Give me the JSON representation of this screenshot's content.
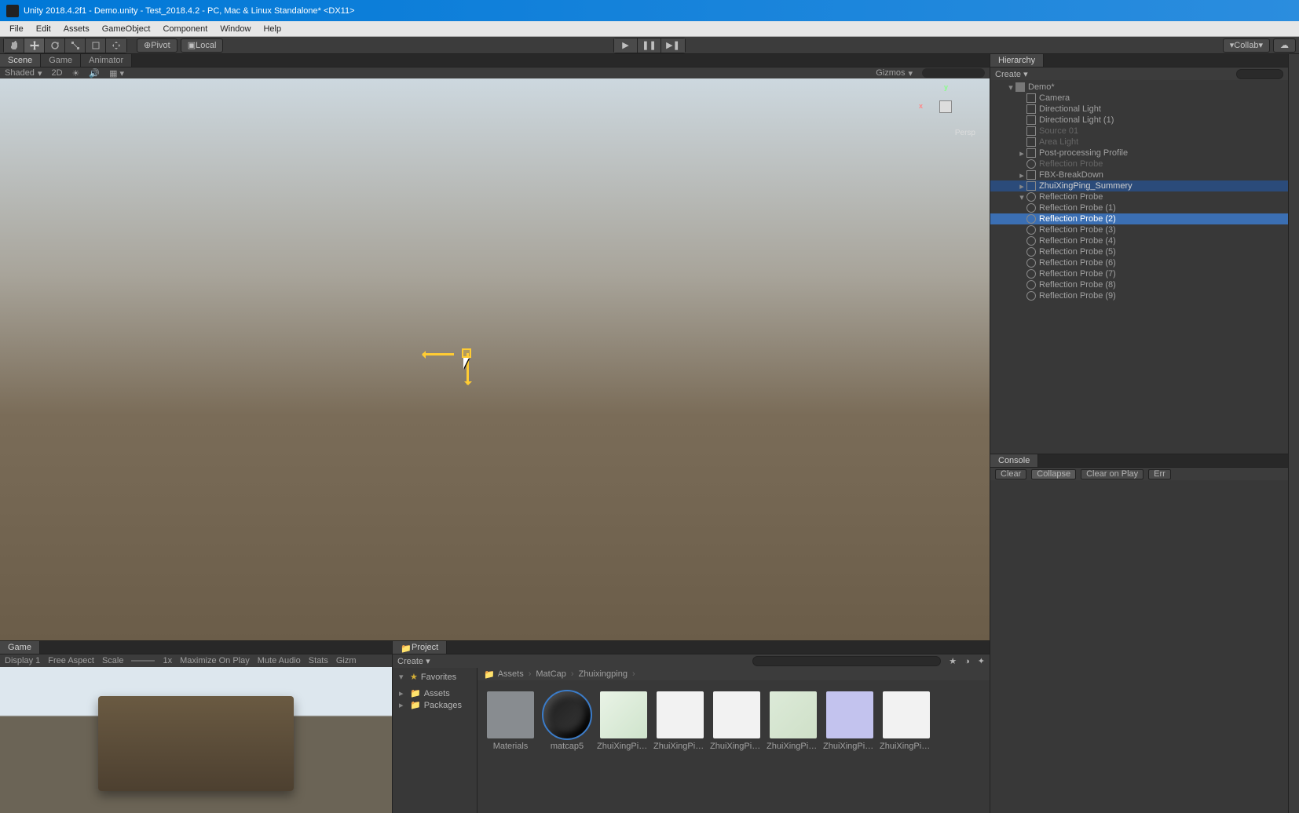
{
  "app_title": "Unity 2018.4.2f1 - Demo.unity - Test_2018.4.2 - PC, Mac & Linux Standalone* <DX11>",
  "menu": [
    "File",
    "Edit",
    "Assets",
    "GameObject",
    "Component",
    "Window",
    "Help"
  ],
  "toolbar": {
    "pivot": "Pivot",
    "local": "Local",
    "collab": "Collab"
  },
  "scene_tabs": {
    "scene": "Scene",
    "game": "Game",
    "animator": "Animator"
  },
  "scene_bar": {
    "shaded": "Shaded",
    "twoD": "2D",
    "gizmos": "Gizmos",
    "persp": "Persp"
  },
  "game_tab": "Game",
  "game_bar": {
    "display": "Display 1",
    "aspect": "Free Aspect",
    "scale": "Scale",
    "scale_val": "1x",
    "maximize": "Maximize On Play",
    "mute": "Mute Audio",
    "stats": "Stats",
    "gizmos": "Gizm"
  },
  "project_tab": "Project",
  "project_toolbar": {
    "create": "Create"
  },
  "project_tree": {
    "fav": "Favorites",
    "assets": "Assets",
    "packages": "Packages"
  },
  "breadcrumb": [
    "Assets",
    "MatCap",
    "Zhuixingping"
  ],
  "assets": [
    {
      "name": "Materials",
      "kind": "folder"
    },
    {
      "name": "matcap5",
      "kind": "dark"
    },
    {
      "name": "ZhuiXingPing…",
      "kind": "green"
    },
    {
      "name": "ZhuiXingPing…",
      "kind": "mesh"
    },
    {
      "name": "ZhuiXingPing…",
      "kind": "white"
    },
    {
      "name": "ZhuiXingPing…",
      "kind": "green2"
    },
    {
      "name": "ZhuiXingPing…",
      "kind": "lav"
    },
    {
      "name": "ZhuiXingPing…",
      "kind": "white"
    }
  ],
  "hierarchy_tab": "Hierarchy",
  "hierarchy_toolbar": {
    "create": "Create"
  },
  "hierarchy": {
    "scene": "Demo*",
    "items": [
      {
        "name": "Camera",
        "dim": false,
        "indent": 2,
        "icon": "go"
      },
      {
        "name": "Directional Light",
        "dim": false,
        "indent": 2,
        "icon": "go"
      },
      {
        "name": "Directional Light (1)",
        "dim": false,
        "indent": 2,
        "icon": "go"
      },
      {
        "name": "Source 01",
        "dim": true,
        "indent": 2,
        "icon": "go"
      },
      {
        "name": "Area Light",
        "dim": true,
        "indent": 2,
        "icon": "go"
      },
      {
        "name": "Post-processing Profile",
        "dim": false,
        "indent": 2,
        "icon": "go",
        "fold": "▸"
      },
      {
        "name": "Reflection Probe",
        "dim": true,
        "indent": 2,
        "icon": "probe"
      },
      {
        "name": "FBX-BreakDown",
        "dim": false,
        "indent": 2,
        "icon": "go",
        "fold": "▸"
      },
      {
        "name": "ZhuiXingPing_Summery",
        "dim": false,
        "indent": 2,
        "icon": "go",
        "fold": "▸",
        "sel": "sel2"
      },
      {
        "name": "Reflection Probe",
        "dim": false,
        "indent": 2,
        "icon": "probe",
        "fold": "▾"
      },
      {
        "name": "Reflection Probe (1)",
        "dim": false,
        "indent": 2,
        "icon": "probe"
      },
      {
        "name": "Reflection Probe (2)",
        "dim": false,
        "indent": 2,
        "icon": "probe",
        "sel": "sel"
      },
      {
        "name": "Reflection Probe (3)",
        "dim": false,
        "indent": 2,
        "icon": "probe"
      },
      {
        "name": "Reflection Probe (4)",
        "dim": false,
        "indent": 2,
        "icon": "probe"
      },
      {
        "name": "Reflection Probe (5)",
        "dim": false,
        "indent": 2,
        "icon": "probe"
      },
      {
        "name": "Reflection Probe (6)",
        "dim": false,
        "indent": 2,
        "icon": "probe"
      },
      {
        "name": "Reflection Probe (7)",
        "dim": false,
        "indent": 2,
        "icon": "probe"
      },
      {
        "name": "Reflection Probe (8)",
        "dim": false,
        "indent": 2,
        "icon": "probe"
      },
      {
        "name": "Reflection Probe (9)",
        "dim": false,
        "indent": 2,
        "icon": "probe"
      }
    ]
  },
  "console_tab": "Console",
  "console_bar": {
    "clear": "Clear",
    "collapse": "Collapse",
    "clear_on_play": "Clear on Play",
    "err": "Err"
  }
}
